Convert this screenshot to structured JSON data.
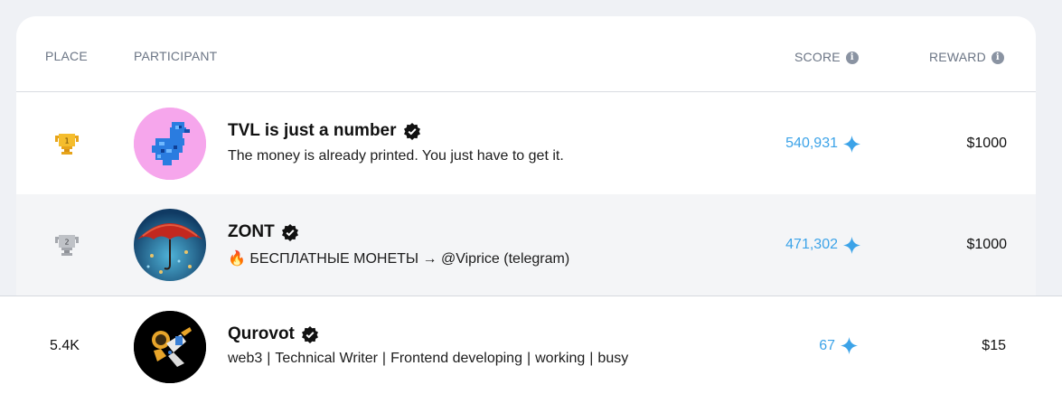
{
  "header": {
    "place": "PLACE",
    "participant": "PARTICIPANT",
    "score": "SCORE",
    "reward": "REWARD"
  },
  "rows": [
    {
      "place_icon": "gold-trophy-icon",
      "place_number": "1",
      "avatar": "pixel-blue-bird-avatar",
      "name": "TVL is just a number",
      "bio": "The money is already printed. You just have to get it.",
      "score": "540,931",
      "reward": "$1000"
    },
    {
      "place_icon": "silver-trophy-icon",
      "place_number": "2",
      "avatar": "red-umbrella-avatar",
      "name": "ZONT",
      "bio_emoji": "🔥",
      "bio": "БЕСПЛАТНЫЕ МОНЕТЫ → @Viprice (telegram)",
      "score": "471,302",
      "reward": "$1000"
    }
  ],
  "current_user": {
    "place": "5.4K",
    "avatar": "astronaut-avatar",
    "name": "Qurovot",
    "bio_parts": [
      "web3",
      "Technical Writer",
      "Frontend developing",
      "working",
      "busy"
    ],
    "bio_separator": "|",
    "score": "67",
    "reward": "$15"
  },
  "colors": {
    "score_blue": "#3ca3e8",
    "gold": "#f2b322",
    "silver": "#b3b6bc",
    "alt_row": "#f4f5f7",
    "page_bg": "#eff1f5"
  }
}
